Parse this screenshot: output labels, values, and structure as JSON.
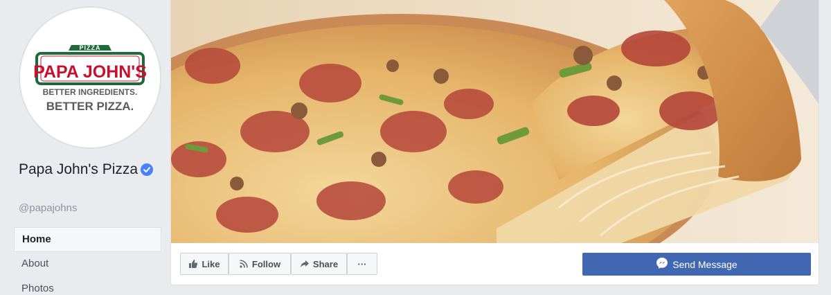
{
  "page": {
    "name": "Papa John's Pizza",
    "handle": "@papajohns",
    "verified": true
  },
  "logo": {
    "top_text": "PIZZA",
    "brand": "PAPA JOHN'S",
    "tagline_1": "BETTER INGREDIENTS.",
    "tagline_2": "BETTER PIZZA.",
    "colors": {
      "red": "#c8102e",
      "green": "#1e6b3a",
      "gray": "#5a5a5a"
    }
  },
  "sidebar": {
    "items": [
      {
        "label": "Home",
        "active": true
      },
      {
        "label": "About",
        "active": false
      },
      {
        "label": "Photos",
        "active": false
      }
    ]
  },
  "actions": {
    "like": "Like",
    "follow": "Follow",
    "share": "Share",
    "more": "···",
    "send_message": "Send Message"
  },
  "colors": {
    "accent": "#4267b2",
    "background": "#e9ebee"
  }
}
